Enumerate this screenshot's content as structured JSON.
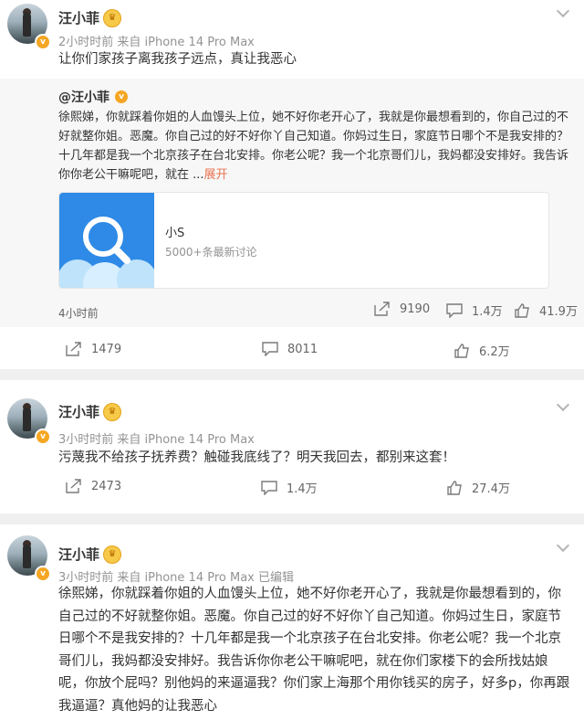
{
  "post1": {
    "username": "汪小菲",
    "meta": "2小时时前  来自 iPhone 14 Pro Max",
    "text": "让你们家孩子离我孩子远点，真让我恶心",
    "repost": {
      "username": "@汪小菲",
      "text_before": "徐熙娣，你就踩着你姐的人血馒头上位，她不好你老开心了，我就是你最想看到的，你自己过的不好就整你姐。恶魔。你自己过的好不好你丫自己知道。你妈过生日，家庭节日哪个不是我安排的？十几年都是我一个北京孩子在台北安排。你老公呢？我一个北京哥们儿，我妈都没安排好。我告诉你你老公干嘛呢吧，就在 ...",
      "expand": "展开",
      "topic_title": "小S",
      "topic_sub": "5000+条最新讨论",
      "time": "4小时前",
      "repost_count": "9190",
      "comment_count": "1.4万",
      "like_count": "41.9万"
    },
    "repost_count": "1479",
    "comment_count": "8011",
    "like_count": "6.2万"
  },
  "post2": {
    "username": "汪小菲",
    "meta": "3小时时前  来自 iPhone 14 Pro Max",
    "text": "污蔑我不给孩子抚养费？触碰我底线了？明天我回去，都别来这套！",
    "repost_count": "2473",
    "comment_count": "1.4万",
    "like_count": "27.4万"
  },
  "post3": {
    "username": "汪小菲",
    "meta": "3小时时前  来自 iPhone 14 Pro Max 已编辑",
    "text": "徐熙娣，你就踩着你姐的人血馒头上位，她不好你老开心了，我就是你最想看到的，你自己过的不好就整你姐。恶魔。你自己过的好不好你丫自己知道。你妈过生日，家庭节日哪个不是我安排的？十几年都是我一个北京孩子在台北安排。你老公呢？我一个北京哥们儿，我妈都没安排好。我告诉你你老公干嘛呢吧，就在你们家楼下的会所找姑娘呢，你放个屁吗？别他妈的来逼逼我？你们家上海那个用你钱买的房子，好多p，你再跟我逼逼？真他妈的让我恶心"
  },
  "colors": {
    "accent": "#eb7350",
    "badge": "#f5a623"
  }
}
